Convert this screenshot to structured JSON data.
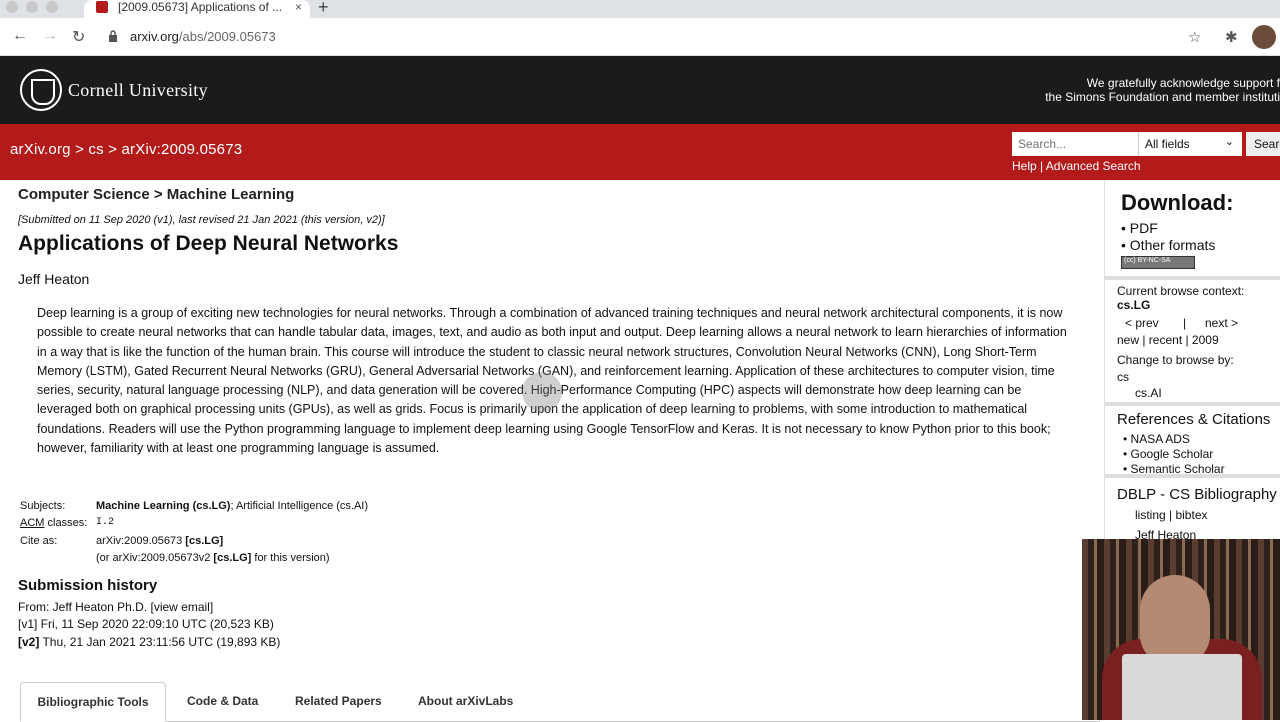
{
  "browser": {
    "tab_title": "[2009.05673] Applications of ...",
    "tab_close": "×",
    "new_tab": "+",
    "url_host": "arxiv.org",
    "url_path": "/abs/2009.05673",
    "back": "←",
    "forward": "→",
    "reload": "↻",
    "star": "☆",
    "extensions": "✱",
    "extensions2": "⋮"
  },
  "header": {
    "university": "Cornell University",
    "ack_line1": "We gratefully acknowledge support f",
    "ack_line2": "the Simons Foundation and member instituti"
  },
  "redbar": {
    "breadcrumb": "arXiv.org > cs > arXiv:2009.05673",
    "search_placeholder": "Search...",
    "search_field": "All fields",
    "search_button": "Searc",
    "help": "Help | Advanced Search"
  },
  "paper": {
    "subject_heading": "Computer Science > Machine Learning",
    "dateline": "[Submitted on 11 Sep 2020 (v1), last revised 21 Jan 2021 (this version, v2)]",
    "title": "Applications of Deep Neural Networks",
    "author": "Jeff Heaton",
    "abstract": "Deep learning is a group of exciting new technologies for neural networks. Through a combination of advanced training techniques and neural network architectural components, it is now possible to create neural networks that can handle tabular data, images, text, and audio as both input and output. Deep learning allows a neural network to learn hierarchies of information in a way that is like the function of the human brain. This course will introduce the student to classic neural network structures, Convolution Neural Networks (CNN), Long Short-Term Memory (LSTM), Gated Recurrent Neural Networks (GRU), General Adversarial Networks (GAN), and reinforcement learning. Application of these architectures to computer vision, time series, security, natural language processing (NLP), and data generation will be covered. High-Performance Computing (HPC) aspects will demonstrate how deep learning can be leveraged both on graphical processing units (GPUs), as well as grids. Focus is primarily upon the application of deep learning to problems, with some introduction to mathematical foundations. Readers will use the Python programming language to implement deep learning using Google TensorFlow and Keras. It is not necessary to know Python prior to this book; however, familiarity with at least one programming language is assumed.",
    "subjects_label": "Subjects:",
    "subjects_primary": "Machine Learning (cs.LG)",
    "subjects_rest": "; Artificial Intelligence (cs.AI)",
    "acm_label_a": "ACM",
    "acm_label_b": " classes:",
    "acm_value": "I.2",
    "cite_label": "Cite as:",
    "cite_id": "arXiv:2009.05673 ",
    "cite_tag": "[cs.LG]",
    "cite2_pre": "(or arXiv:2009.05673v2 ",
    "cite2_tag": "[cs.LG]",
    "cite2_post": " for this version)"
  },
  "history": {
    "heading": "Submission history",
    "from": "From: Jeff Heaton Ph.D. [view email]",
    "v1": "[v1] Fri, 11 Sep 2020 22:09:10 UTC (20,523 KB)",
    "v2_tag": "[v2]",
    "v2": " Thu, 21 Jan 2021 23:11:56 UTC (19,893 KB)"
  },
  "tabs": [
    "Bibliographic Tools",
    "Code & Data",
    "Related Papers",
    "About arXivLabs"
  ],
  "sidebar": {
    "download": "Download:",
    "pdf": "• PDF",
    "other": "• Other formats",
    "license": "(cc) BY-NC-SA",
    "context_label": "Current browse context:",
    "context_value": "cs.LG",
    "prev": "< prev",
    "sep": "|",
    "next": "next >",
    "new_recent": "new | recent | 2009",
    "change_label": "Change to browse by:",
    "cs": "cs",
    "csai": "cs.AI",
    "refs_head": "References & Citations",
    "nasa": "• NASA ADS",
    "google": "• Google Scholar",
    "semantic": "• Semantic Scholar",
    "dblp_head": "DBLP - CS Bibliography",
    "listing": "listing | bibtex",
    "dblp_author": "Jeff Heaton"
  }
}
